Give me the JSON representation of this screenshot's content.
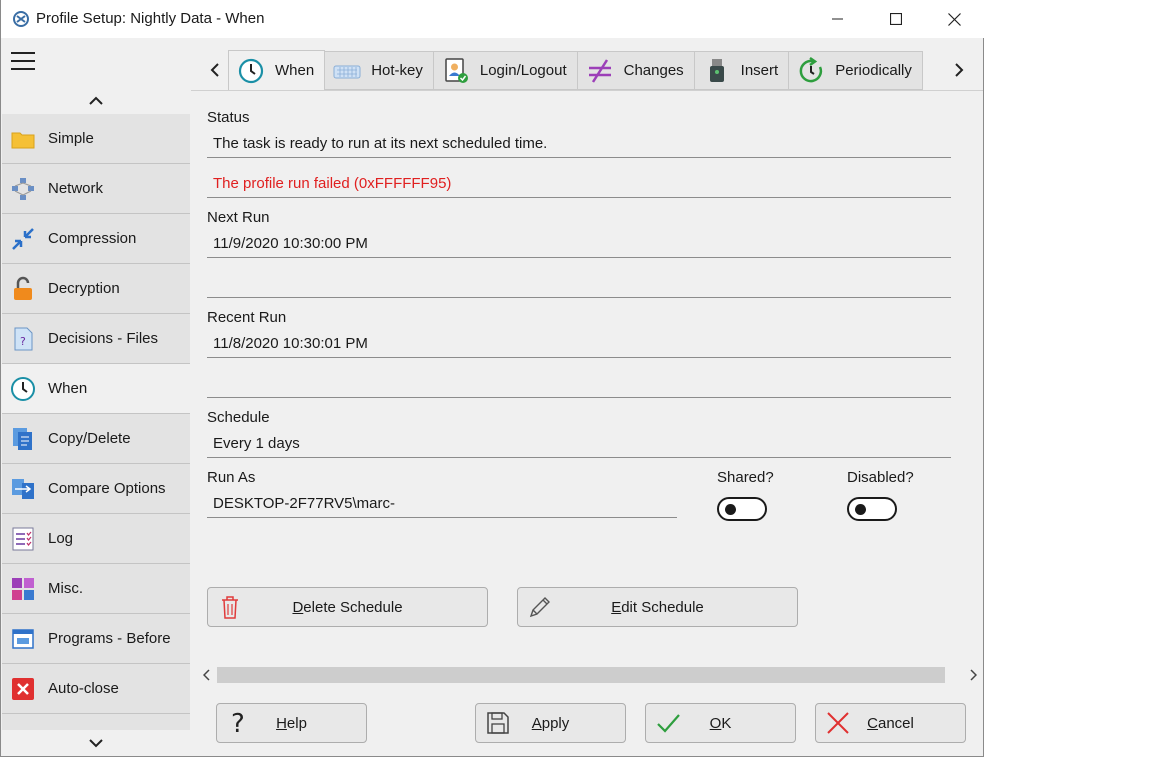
{
  "window": {
    "title": "Profile Setup: Nightly Data - When"
  },
  "sidebar": {
    "items": [
      {
        "label": "Simple",
        "icon": "folder-icon"
      },
      {
        "label": "Network",
        "icon": "network-icon"
      },
      {
        "label": "Compression",
        "icon": "compress-arrows-icon"
      },
      {
        "label": "Decryption",
        "icon": "padlock-open-icon"
      },
      {
        "label": "Decisions - Files",
        "icon": "question-document-icon"
      },
      {
        "label": "When",
        "icon": "clock-icon",
        "active": true
      },
      {
        "label": "Copy/Delete",
        "icon": "documents-icon"
      },
      {
        "label": "Compare Options",
        "icon": "compare-icon"
      },
      {
        "label": "Log",
        "icon": "checklist-icon"
      },
      {
        "label": "Misc.",
        "icon": "grid-shapes-icon"
      },
      {
        "label": "Programs - Before",
        "icon": "program-window-icon"
      },
      {
        "label": "Auto-close",
        "icon": "red-x-icon"
      }
    ]
  },
  "tabs": [
    {
      "label": "When",
      "icon": "clock-icon",
      "active": true
    },
    {
      "label": "Hot-key",
      "icon": "keyboard-icon"
    },
    {
      "label": "Login/Logout",
      "icon": "user-badge-icon"
    },
    {
      "label": "Changes",
      "icon": "not-equal-icon"
    },
    {
      "label": "Insert",
      "icon": "usb-drive-icon"
    },
    {
      "label": "Periodically",
      "icon": "refresh-clock-icon"
    }
  ],
  "status": {
    "label": "Status",
    "value": "The task is ready to run at its next scheduled time.",
    "error": "The profile run failed (0xFFFFFF95)"
  },
  "next_run": {
    "label": "Next Run",
    "value": "11/9/2020 10:30:00 PM"
  },
  "recent_run": {
    "label": "Recent Run",
    "value": "11/8/2020 10:30:01 PM"
  },
  "schedule": {
    "label": "Schedule",
    "value": "Every 1 days"
  },
  "run_as": {
    "label": "Run As",
    "value": "DESKTOP-2F77RV5\\marc-"
  },
  "shared": {
    "label": "Shared?",
    "on": false
  },
  "disabled": {
    "label": "Disabled?",
    "on": false
  },
  "actions": {
    "delete_first": "D",
    "delete_rest": "elete Schedule",
    "edit_first": "E",
    "edit_rest": "dit Schedule"
  },
  "footer": {
    "help_first": "H",
    "help_rest": "elp",
    "apply_first": "A",
    "apply_rest": "pply",
    "ok_first": "O",
    "ok_rest": "K",
    "cancel_first": "C",
    "cancel_rest": "ancel"
  },
  "colors": {
    "error": "#e02020",
    "accent_teal": "#1a8fa6",
    "ok_green": "#2e9e3e",
    "cancel_red": "#e03030"
  }
}
